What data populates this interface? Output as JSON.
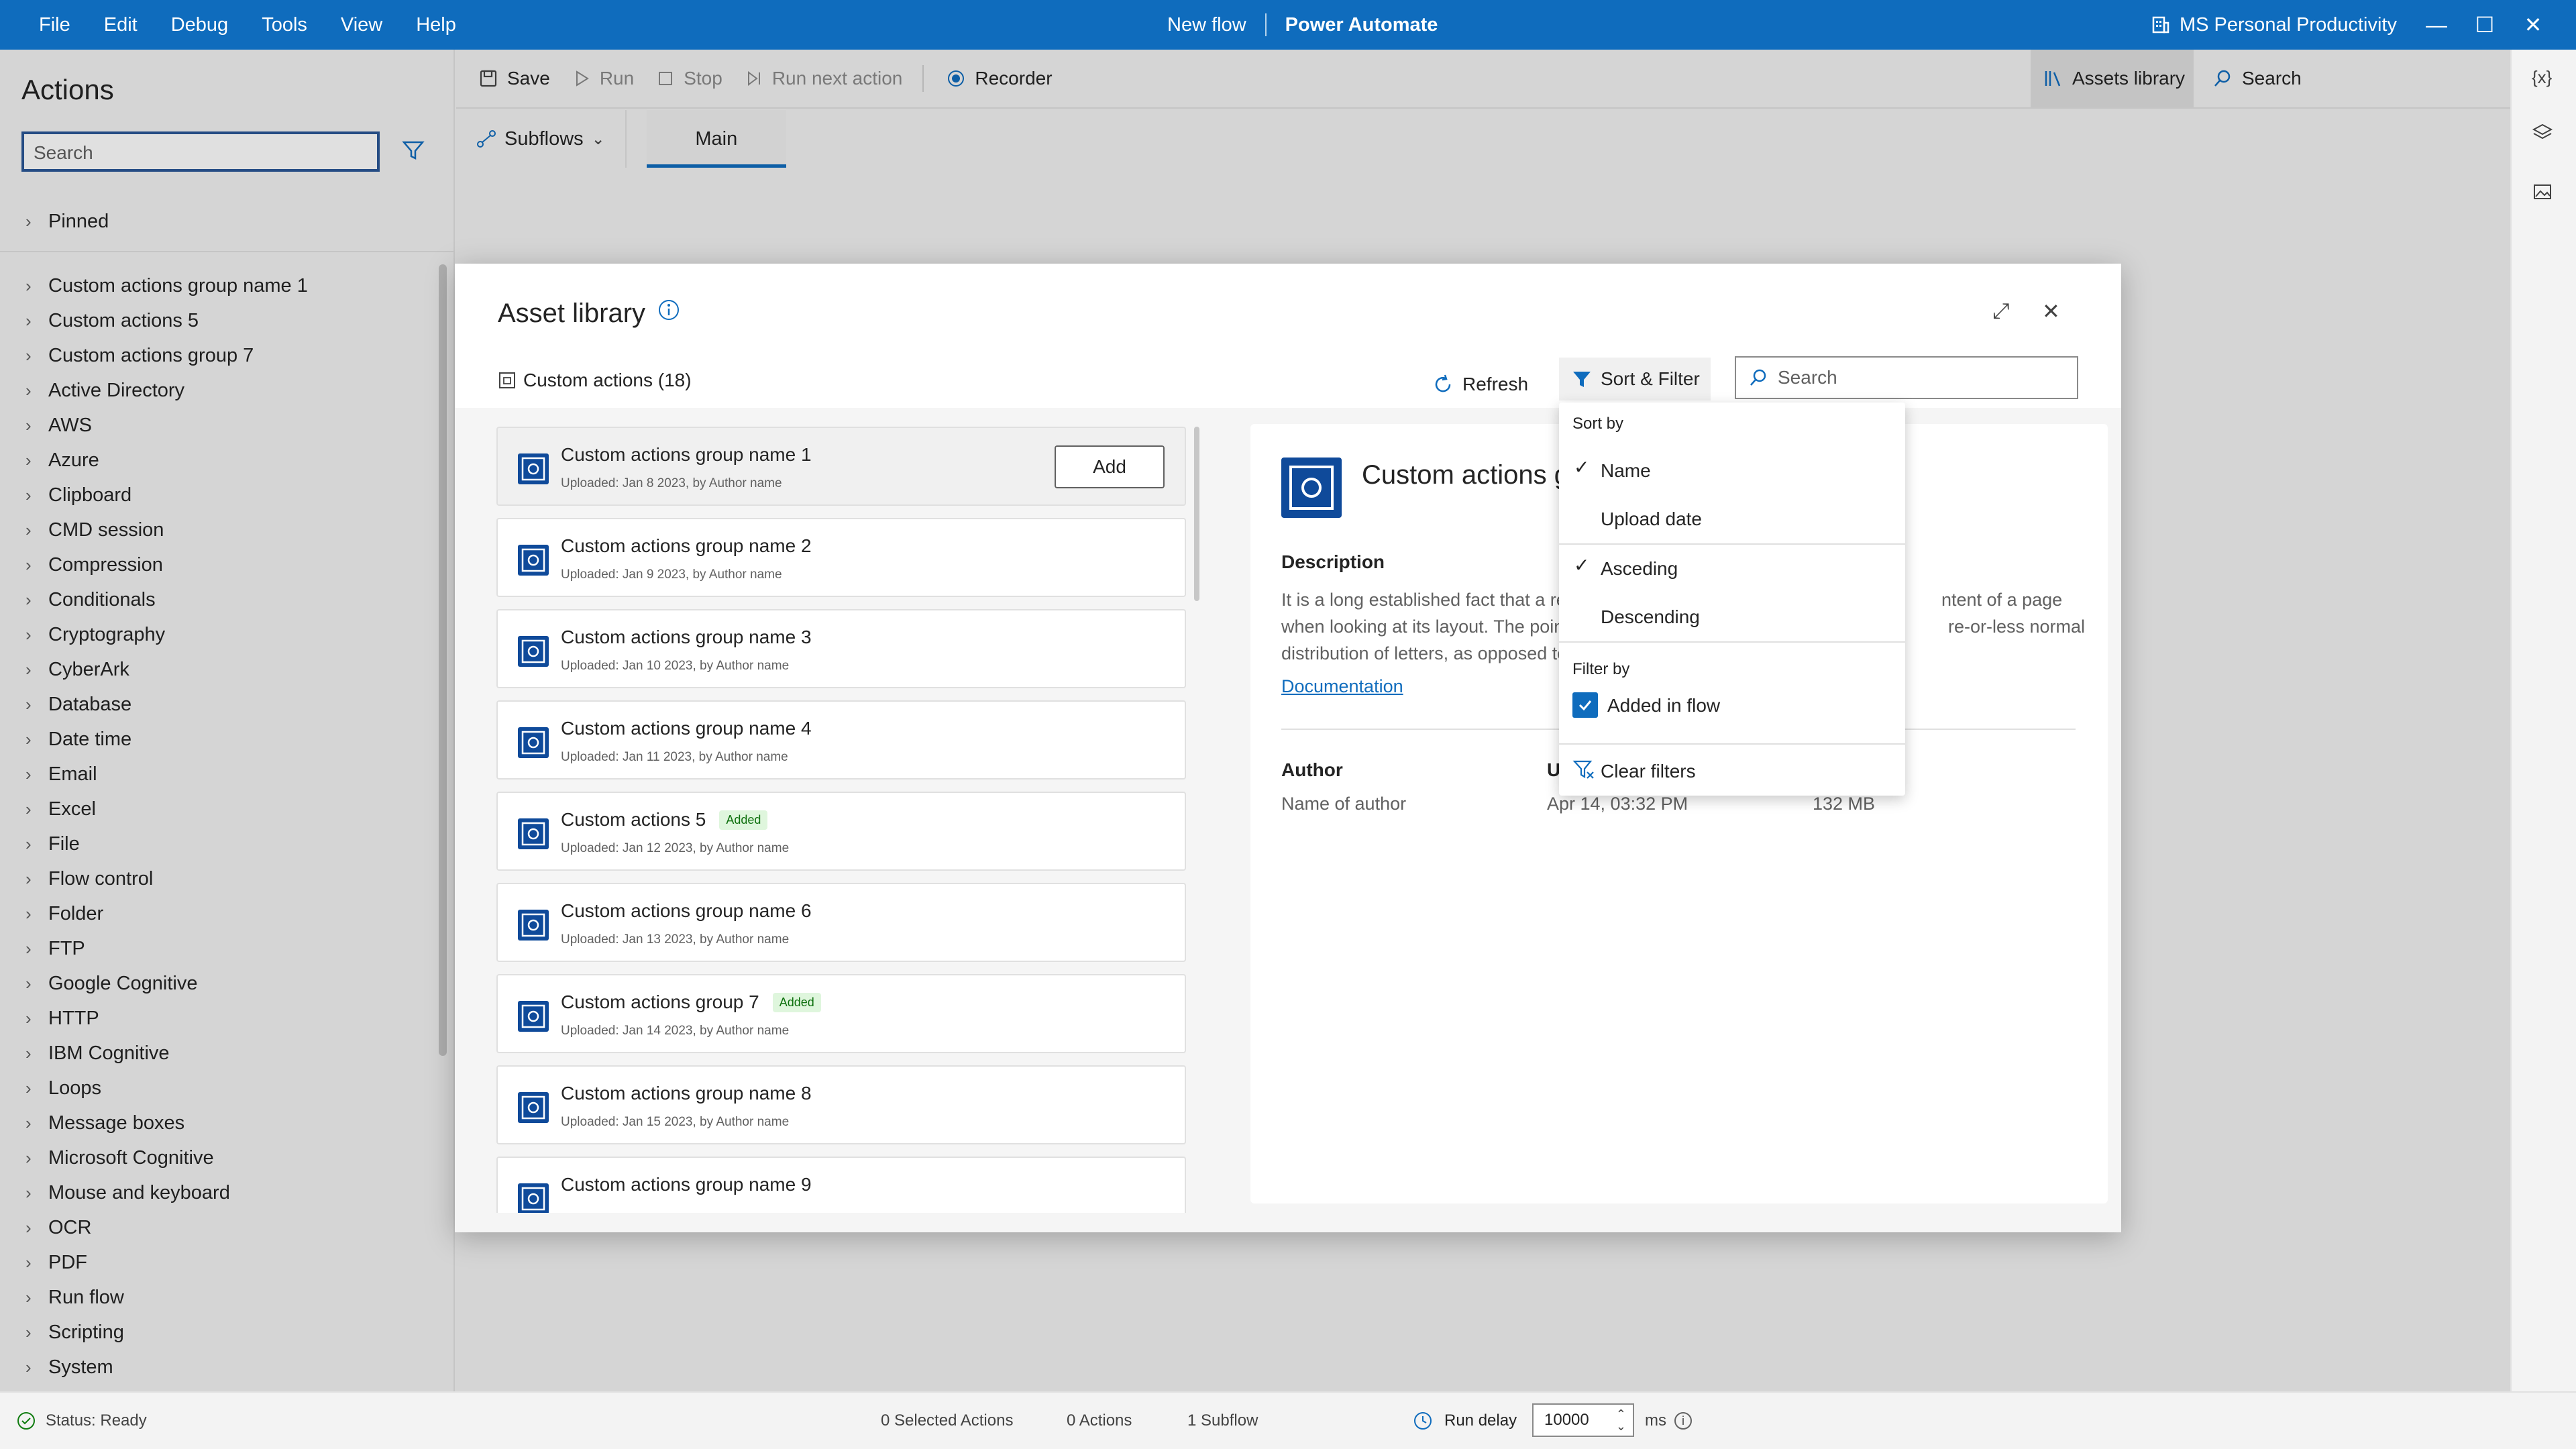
{
  "titlebar": {
    "menu": [
      "File",
      "Edit",
      "Debug",
      "Tools",
      "View",
      "Help"
    ],
    "flow_name": "New flow",
    "app_name": "Power Automate",
    "environment": "MS Personal Productivity"
  },
  "actions_panel": {
    "title": "Actions",
    "search_placeholder": "Search",
    "pinned": "Pinned",
    "items": [
      "Custom actions group name 1",
      "Custom actions 5",
      "Custom actions group 7",
      "Active Directory",
      "AWS",
      "Azure",
      "Clipboard",
      "CMD session",
      "Compression",
      "Conditionals",
      "Cryptography",
      "CyberArk",
      "Database",
      "Date time",
      "Email",
      "Excel",
      "File",
      "Flow control",
      "Folder",
      "FTP",
      "Google Cognitive",
      "HTTP",
      "IBM Cognitive",
      "Loops",
      "Message boxes",
      "Microsoft Cognitive",
      "Mouse and keyboard",
      "OCR",
      "PDF",
      "Run flow",
      "Scripting",
      "System"
    ]
  },
  "toolbar": {
    "save": "Save",
    "run": "Run",
    "stop": "Stop",
    "run_next": "Run next action",
    "recorder": "Recorder",
    "assets_library": "Assets library",
    "search": "Search"
  },
  "tabs": {
    "subflows": "Subflows",
    "main": "Main"
  },
  "dialog": {
    "title": "Asset library",
    "custom_actions_count": "Custom actions (18)",
    "refresh": "Refresh",
    "sort_filter": "Sort & Filter",
    "search_placeholder": "Search",
    "add_button": "Add",
    "items": [
      {
        "name": "Custom actions group name 1",
        "sub": "Uploaded: Jan 8 2023, by Author name",
        "badge": ""
      },
      {
        "name": "Custom actions group name 2",
        "sub": "Uploaded: Jan 9 2023, by Author name",
        "badge": ""
      },
      {
        "name": "Custom actions group name 3",
        "sub": "Uploaded: Jan 10 2023, by Author name",
        "badge": ""
      },
      {
        "name": "Custom actions group name 4",
        "sub": "Uploaded: Jan 11 2023, by Author name",
        "badge": ""
      },
      {
        "name": "Custom actions 5",
        "sub": "Uploaded: Jan 12 2023, by Author name",
        "badge": "Added"
      },
      {
        "name": "Custom actions group name 6",
        "sub": "Uploaded: Jan 13 2023, by Author name",
        "badge": ""
      },
      {
        "name": "Custom actions group 7",
        "sub": "Uploaded: Jan 14 2023, by Author name",
        "badge": "Added"
      },
      {
        "name": "Custom actions group name 8",
        "sub": "Uploaded: Jan 15 2023, by Author name",
        "badge": ""
      },
      {
        "name": "Custom actions group name 9",
        "sub": "",
        "badge": ""
      }
    ],
    "detail": {
      "title": "Custom actions group name 1",
      "description_label": "Description",
      "description_line1a": "It is a long established fact that a rea",
      "description_line1b": "ntent of a page",
      "description_line2a": "when looking at its layout. The poin",
      "description_line2b": "re-or-less normal",
      "description_line3": "letters, as opposed to",
      "description_line3a": "distribution of letters, as opposed to",
      "documentation": "Documentation",
      "author_label": "Author",
      "author_value": "Name of author",
      "upload_label": "Upo",
      "upload_value": "Apr 14, 03:32 PM",
      "size_value": "132 MB"
    },
    "dropdown": {
      "sort_by": "Sort by",
      "name": "Name",
      "upload_date": "Upload date",
      "ascending": "Asceding",
      "descending": "Descending",
      "filter_by": "Filter by",
      "added_in_flow": "Added in flow",
      "clear_filters": "Clear filters"
    }
  },
  "status": {
    "status": "Status: Ready",
    "selected": "0 Selected Actions",
    "actions": "0 Actions",
    "subflow": "1 Subflow",
    "run_delay_label": "Run delay",
    "run_delay_value": "10000",
    "ms": "ms"
  },
  "colors": {
    "accent": "#0f6cbd",
    "badge_bg": "#dff6dd",
    "badge_fg": "#0e700e"
  }
}
